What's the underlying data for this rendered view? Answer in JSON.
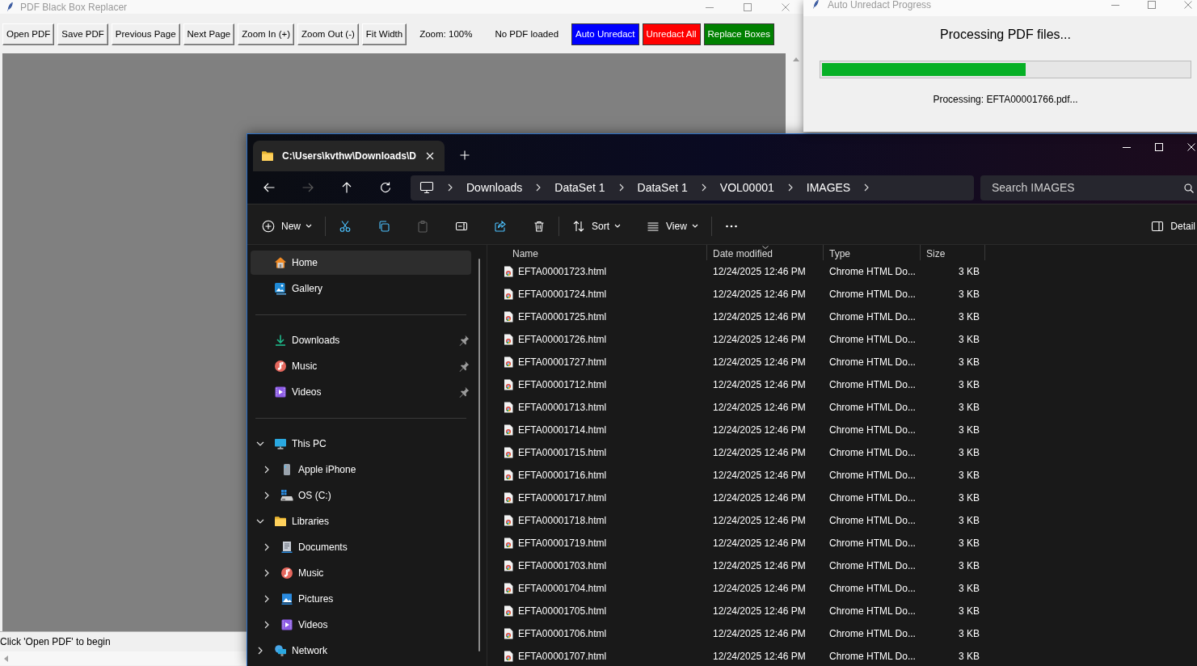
{
  "pdf_app": {
    "window": {
      "title": "PDF Black Box Replacer"
    },
    "toolbar": [
      {
        "kind": "button",
        "label": "Open PDF"
      },
      {
        "kind": "button",
        "label": "Save PDF"
      },
      {
        "kind": "button",
        "label": "Previous Page"
      },
      {
        "kind": "button",
        "label": "Next Page"
      },
      {
        "kind": "button",
        "label": "Zoom In (+)"
      },
      {
        "kind": "button",
        "label": "Zoom Out (-)"
      },
      {
        "kind": "button",
        "label": "Fit Width"
      },
      {
        "kind": "label",
        "label": "Zoom: 100%"
      },
      {
        "kind": "label",
        "label": "No PDF loaded"
      },
      {
        "kind": "button",
        "label": "Auto Unredact",
        "color": "#0000ff"
      },
      {
        "kind": "button",
        "label": "Unredact All",
        "color": "#ff0000"
      },
      {
        "kind": "button",
        "label": "Replace Boxes",
        "color": "#008000"
      }
    ],
    "status_bar": "Click 'Open PDF' to begin"
  },
  "progress_dialog": {
    "window": {
      "title": "Auto Unredact Progress"
    },
    "heading": "Processing PDF files...",
    "progress": {
      "level": 0.555
    },
    "message": "Processing: EFTA00001766.pdf..."
  },
  "explorer": {
    "tabs": [
      {
        "label": "C:\\Users\\kvthw\\Downloads\\D",
        "selected": true
      }
    ],
    "nav_buttons": [
      {
        "kind": "back",
        "disabled": false
      },
      {
        "kind": "forward",
        "disabled": true
      },
      {
        "kind": "up",
        "disabled": false
      },
      {
        "kind": "refresh",
        "disabled": false
      }
    ],
    "breadcrumb": [
      "Downloads",
      "DataSet 1",
      "DataSet 1",
      "VOL00001",
      "IMAGES"
    ],
    "search": {
      "placeholder": "Search IMAGES"
    },
    "commands": [
      {
        "kind": "new",
        "label": "New",
        "disabled": false
      },
      {
        "kind": "separator"
      },
      {
        "kind": "cut",
        "disabled": false
      },
      {
        "kind": "copy",
        "disabled": false
      },
      {
        "kind": "paste",
        "disabled": true
      },
      {
        "kind": "rename",
        "disabled": false
      },
      {
        "kind": "share",
        "disabled": false
      },
      {
        "kind": "delete",
        "disabled": false
      },
      {
        "kind": "separator"
      },
      {
        "kind": "sort",
        "label": "Sort",
        "disabled": false
      },
      {
        "kind": "view",
        "label": "View",
        "disabled": false
      },
      {
        "kind": "separator"
      },
      {
        "kind": "more",
        "disabled": false
      },
      {
        "kind": "details",
        "label": "Detail",
        "disabled": false
      }
    ],
    "sidebar": {
      "sections": [
        {
          "items": [
            {
              "kind": "home",
              "label": "Home",
              "selected": true
            },
            {
              "kind": "gallery",
              "label": "Gallery",
              "selected": false
            }
          ]
        },
        {
          "items": [
            {
              "kind": "downloads",
              "label": "Downloads",
              "selected": false,
              "pinned": true
            },
            {
              "kind": "music",
              "label": "Music",
              "selected": false,
              "pinned": true
            },
            {
              "kind": "videos",
              "label": "Videos",
              "selected": false,
              "pinned": true
            }
          ]
        },
        {
          "items": [
            {
              "kind": "pc",
              "label": "This PC",
              "selected": false,
              "expanded": true,
              "children": [
                {
                  "kind": "phone",
                  "label": "Apple iPhone",
                  "selected": false,
                  "expanded": false
                },
                {
                  "kind": "drive",
                  "label": "OS (C:)",
                  "selected": false,
                  "expanded": false
                }
              ]
            },
            {
              "kind": "library",
              "label": "Libraries",
              "selected": false,
              "expanded": true,
              "children": [
                {
                  "kind": "documents",
                  "label": "Documents",
                  "selected": false,
                  "expanded": false
                },
                {
                  "kind": "music",
                  "label": "Music",
                  "selected": false,
                  "expanded": false
                },
                {
                  "kind": "pictures",
                  "label": "Pictures",
                  "selected": false,
                  "expanded": false
                },
                {
                  "kind": "videos",
                  "label": "Videos",
                  "selected": false,
                  "expanded": false
                }
              ]
            },
            {
              "kind": "network",
              "label": "Network",
              "selected": false,
              "expanded": false
            }
          ]
        }
      ]
    },
    "columns": [
      {
        "label": "Name",
        "sorted": false
      },
      {
        "label": "Date modified",
        "sorted": true
      },
      {
        "label": "Type",
        "sorted": false
      },
      {
        "label": "Size",
        "sorted": false
      }
    ],
    "rows": [
      {
        "name": "EFTA00001723.html",
        "date_modified": "12/24/2025 12:46 PM",
        "type": "Chrome HTML Do...",
        "size": "3 KB",
        "selected": false
      },
      {
        "name": "EFTA00001724.html",
        "date_modified": "12/24/2025 12:46 PM",
        "type": "Chrome HTML Do...",
        "size": "3 KB",
        "selected": false
      },
      {
        "name": "EFTA00001725.html",
        "date_modified": "12/24/2025 12:46 PM",
        "type": "Chrome HTML Do...",
        "size": "3 KB",
        "selected": false
      },
      {
        "name": "EFTA00001726.html",
        "date_modified": "12/24/2025 12:46 PM",
        "type": "Chrome HTML Do...",
        "size": "3 KB",
        "selected": false
      },
      {
        "name": "EFTA00001727.html",
        "date_modified": "12/24/2025 12:46 PM",
        "type": "Chrome HTML Do...",
        "size": "3 KB",
        "selected": false
      },
      {
        "name": "EFTA00001712.html",
        "date_modified": "12/24/2025 12:46 PM",
        "type": "Chrome HTML Do...",
        "size": "3 KB",
        "selected": false
      },
      {
        "name": "EFTA00001713.html",
        "date_modified": "12/24/2025 12:46 PM",
        "type": "Chrome HTML Do...",
        "size": "3 KB",
        "selected": false
      },
      {
        "name": "EFTA00001714.html",
        "date_modified": "12/24/2025 12:46 PM",
        "type": "Chrome HTML Do...",
        "size": "3 KB",
        "selected": false
      },
      {
        "name": "EFTA00001715.html",
        "date_modified": "12/24/2025 12:46 PM",
        "type": "Chrome HTML Do...",
        "size": "3 KB",
        "selected": false
      },
      {
        "name": "EFTA00001716.html",
        "date_modified": "12/24/2025 12:46 PM",
        "type": "Chrome HTML Do...",
        "size": "3 KB",
        "selected": false
      },
      {
        "name": "EFTA00001717.html",
        "date_modified": "12/24/2025 12:46 PM",
        "type": "Chrome HTML Do...",
        "size": "3 KB",
        "selected": false
      },
      {
        "name": "EFTA00001718.html",
        "date_modified": "12/24/2025 12:46 PM",
        "type": "Chrome HTML Do...",
        "size": "3 KB",
        "selected": false
      },
      {
        "name": "EFTA00001719.html",
        "date_modified": "12/24/2025 12:46 PM",
        "type": "Chrome HTML Do...",
        "size": "3 KB",
        "selected": false
      },
      {
        "name": "EFTA00001703.html",
        "date_modified": "12/24/2025 12:46 PM",
        "type": "Chrome HTML Do...",
        "size": "3 KB",
        "selected": false
      },
      {
        "name": "EFTA00001704.html",
        "date_modified": "12/24/2025 12:46 PM",
        "type": "Chrome HTML Do...",
        "size": "3 KB",
        "selected": false
      },
      {
        "name": "EFTA00001705.html",
        "date_modified": "12/24/2025 12:46 PM",
        "type": "Chrome HTML Do...",
        "size": "3 KB",
        "selected": false
      },
      {
        "name": "EFTA00001706.html",
        "date_modified": "12/24/2025 12:46 PM",
        "type": "Chrome HTML Do...",
        "size": "3 KB",
        "selected": false
      },
      {
        "name": "EFTA00001707.html",
        "date_modified": "12/24/2025 12:46 PM",
        "type": "Chrome HTML Do...",
        "size": "3 KB",
        "selected": false
      }
    ]
  }
}
